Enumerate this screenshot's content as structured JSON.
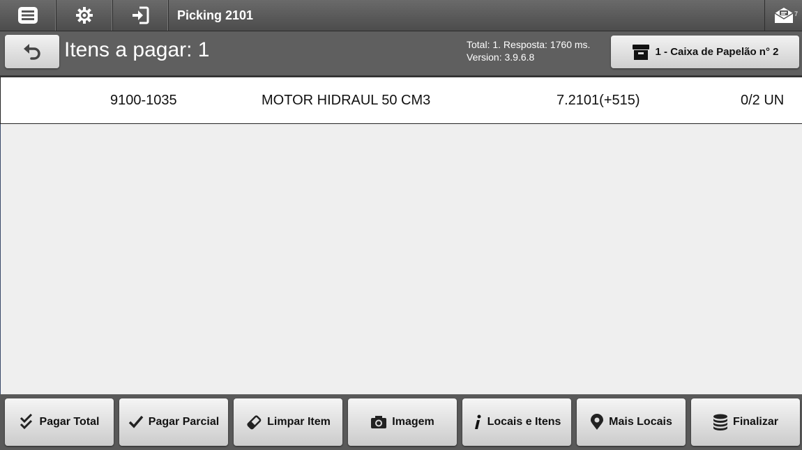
{
  "topbar": {
    "title": "Picking 2101",
    "mail_count": "7",
    "icons": [
      "menu-icon",
      "gear-icon",
      "login-icon",
      "mail-icon"
    ]
  },
  "header": {
    "title": "Itens a pagar: 1",
    "info_line1": "Total: 1. Resposta: 1760 ms.",
    "info_line2": "Version: 3.9.6.8",
    "box_label": "1 - Caixa de Papelão n° 2"
  },
  "items": [
    {
      "code": "9100-1035",
      "description": "MOTOR HIDRAUL 50 CM3",
      "location": "7.2101(+515)",
      "quantity": "0/2 UN"
    }
  ],
  "actions": {
    "pagar_total": "Pagar Total",
    "pagar_parcial": "Pagar Parcial",
    "limpar_item": "Limpar Item",
    "imagem": "Imagem",
    "locais_itens": "Locais e Itens",
    "mais_locais": "Mais Locais",
    "finalizar": "Finalizar"
  }
}
